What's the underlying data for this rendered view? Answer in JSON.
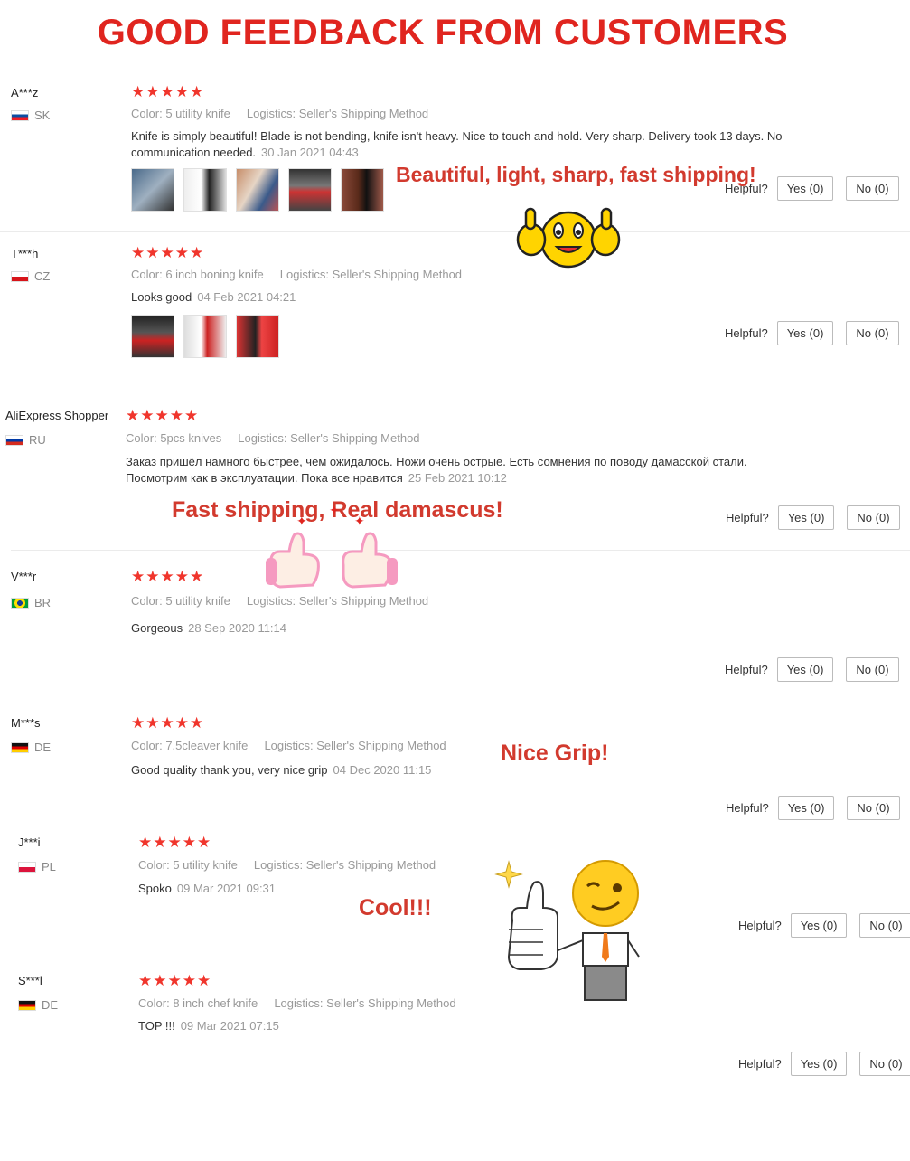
{
  "header": {
    "title": "GOOD FEEDBACK FROM CUSTOMERS"
  },
  "labels": {
    "color": "Color:",
    "logistics": "Logistics:",
    "helpful": "Helpful?"
  },
  "stars": "★★★★★",
  "reviews": [
    {
      "name": "A***z",
      "country": "SK",
      "color": "5 utility knife",
      "logistics": "Seller's Shipping Method",
      "text": "Knife is simply beautiful! Blade is not bending, knife isn't heavy. Nice to touch and hold. Very sharp. Delivery took 13 days. No communication needed.",
      "date": "30 Jan 2021 04:43",
      "yes": "Yes (0)",
      "no": "No (0)",
      "rating": 5,
      "photos": 5
    },
    {
      "name": "T***h",
      "country": "CZ",
      "color": "6 inch boning knife",
      "logistics": "Seller's Shipping Method",
      "text": "Looks good",
      "date": "04 Feb 2021 04:21",
      "yes": "Yes (0)",
      "no": "No (0)",
      "rating": 5,
      "photos": 3
    },
    {
      "name": "AliExpress Shopper",
      "country": "RU",
      "color": "5pcs knives",
      "logistics": "Seller's Shipping Method",
      "text": "Заказ пришёл намного быстрее, чем ожидалось. Ножи очень острые. Есть сомнения по поводу дамасской стали. Посмотрим как в эксплуатации. Пока все нравится",
      "date": "25 Feb 2021 10:12",
      "yes": "Yes (0)",
      "no": "No (0)",
      "rating": 5,
      "photos": 0
    },
    {
      "name": "V***r",
      "country": "BR",
      "color": "5 utility knife",
      "logistics": "Seller's Shipping Method",
      "text": "Gorgeous",
      "date": "28 Sep 2020 11:14",
      "yes": "Yes (0)",
      "no": "No (0)",
      "rating": 5,
      "photos": 0
    },
    {
      "name": "M***s",
      "country": "DE",
      "color": "7.5cleaver knife",
      "logistics": "Seller's Shipping Method",
      "text": "Good quality thank you, very nice grip",
      "date": "04 Dec 2020 11:15",
      "yes": "Yes (0)",
      "no": "No (0)",
      "rating": 5,
      "photos": 0
    },
    {
      "name": "J***i",
      "country": "PL",
      "color": "5 utility knife",
      "logistics": "Seller's Shipping Method",
      "text": "Spoko",
      "date": "09 Mar 2021 09:31",
      "yes": "Yes (0)",
      "no": "No (0)",
      "rating": 5,
      "photos": 0
    },
    {
      "name": "S***l",
      "country": "DE",
      "color": "8 inch chef knife",
      "logistics": "Seller's Shipping Method",
      "text": "TOP !!!",
      "date": "09 Mar 2021 07:15",
      "yes": "Yes (0)",
      "no": "No (0)",
      "rating": 5,
      "photos": 0
    }
  ],
  "annotations": {
    "a1": "Beautiful, light, sharp, fast shipping!",
    "a2": "Fast shipping, Real damascus!",
    "a3": "Nice Grip!",
    "a4": "Cool!!!"
  },
  "icons": [
    "star-icon",
    "flag-icon",
    "thumbs-up-smiley-icon",
    "pink-thumbs-up-icon",
    "winking-thumbs-up-man-icon",
    "sparkle-icon"
  ],
  "colors": {
    "title": "#e0251f",
    "stars": "#f0352c",
    "annotation": "#d23a2e"
  }
}
